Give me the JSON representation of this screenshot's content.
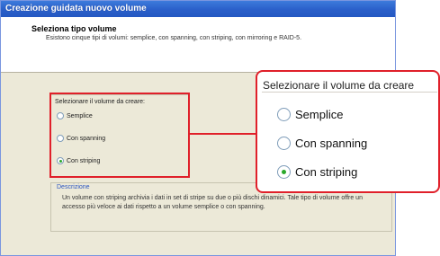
{
  "window": {
    "title": "Creazione guidata nuovo volume",
    "header_title": "Seleziona tipo volume",
    "header_subtitle": "Esistono cinque tipi di volumi: semplice, con spanning, con striping, con mirroring e RAID-5."
  },
  "volume_type_group": {
    "legend": "Selezionare il volume da creare:",
    "options": [
      {
        "label": "Semplice",
        "selected": false
      },
      {
        "label": "Con spanning",
        "selected": false
      },
      {
        "label": "Con striping",
        "selected": true
      }
    ]
  },
  "description": {
    "legend": "Descrizione",
    "text": "Un volume con striping archivia i dati in set di stripe su due o più dischi dinamici. Tale tipo di volume offre un accesso più veloce ai dati rispetto a un volume semplice o con spanning."
  },
  "zoom_callout": {
    "legend": "Selezionare il volume da creare",
    "options": [
      {
        "label": "Semplice",
        "selected": false
      },
      {
        "label": "Con spanning",
        "selected": false
      },
      {
        "label": "Con striping",
        "selected": true
      }
    ]
  },
  "colors": {
    "highlight_red": "#e0202a",
    "titlebar_blue": "#2a5fc9",
    "radio_selected_green": "#2aa82a"
  }
}
